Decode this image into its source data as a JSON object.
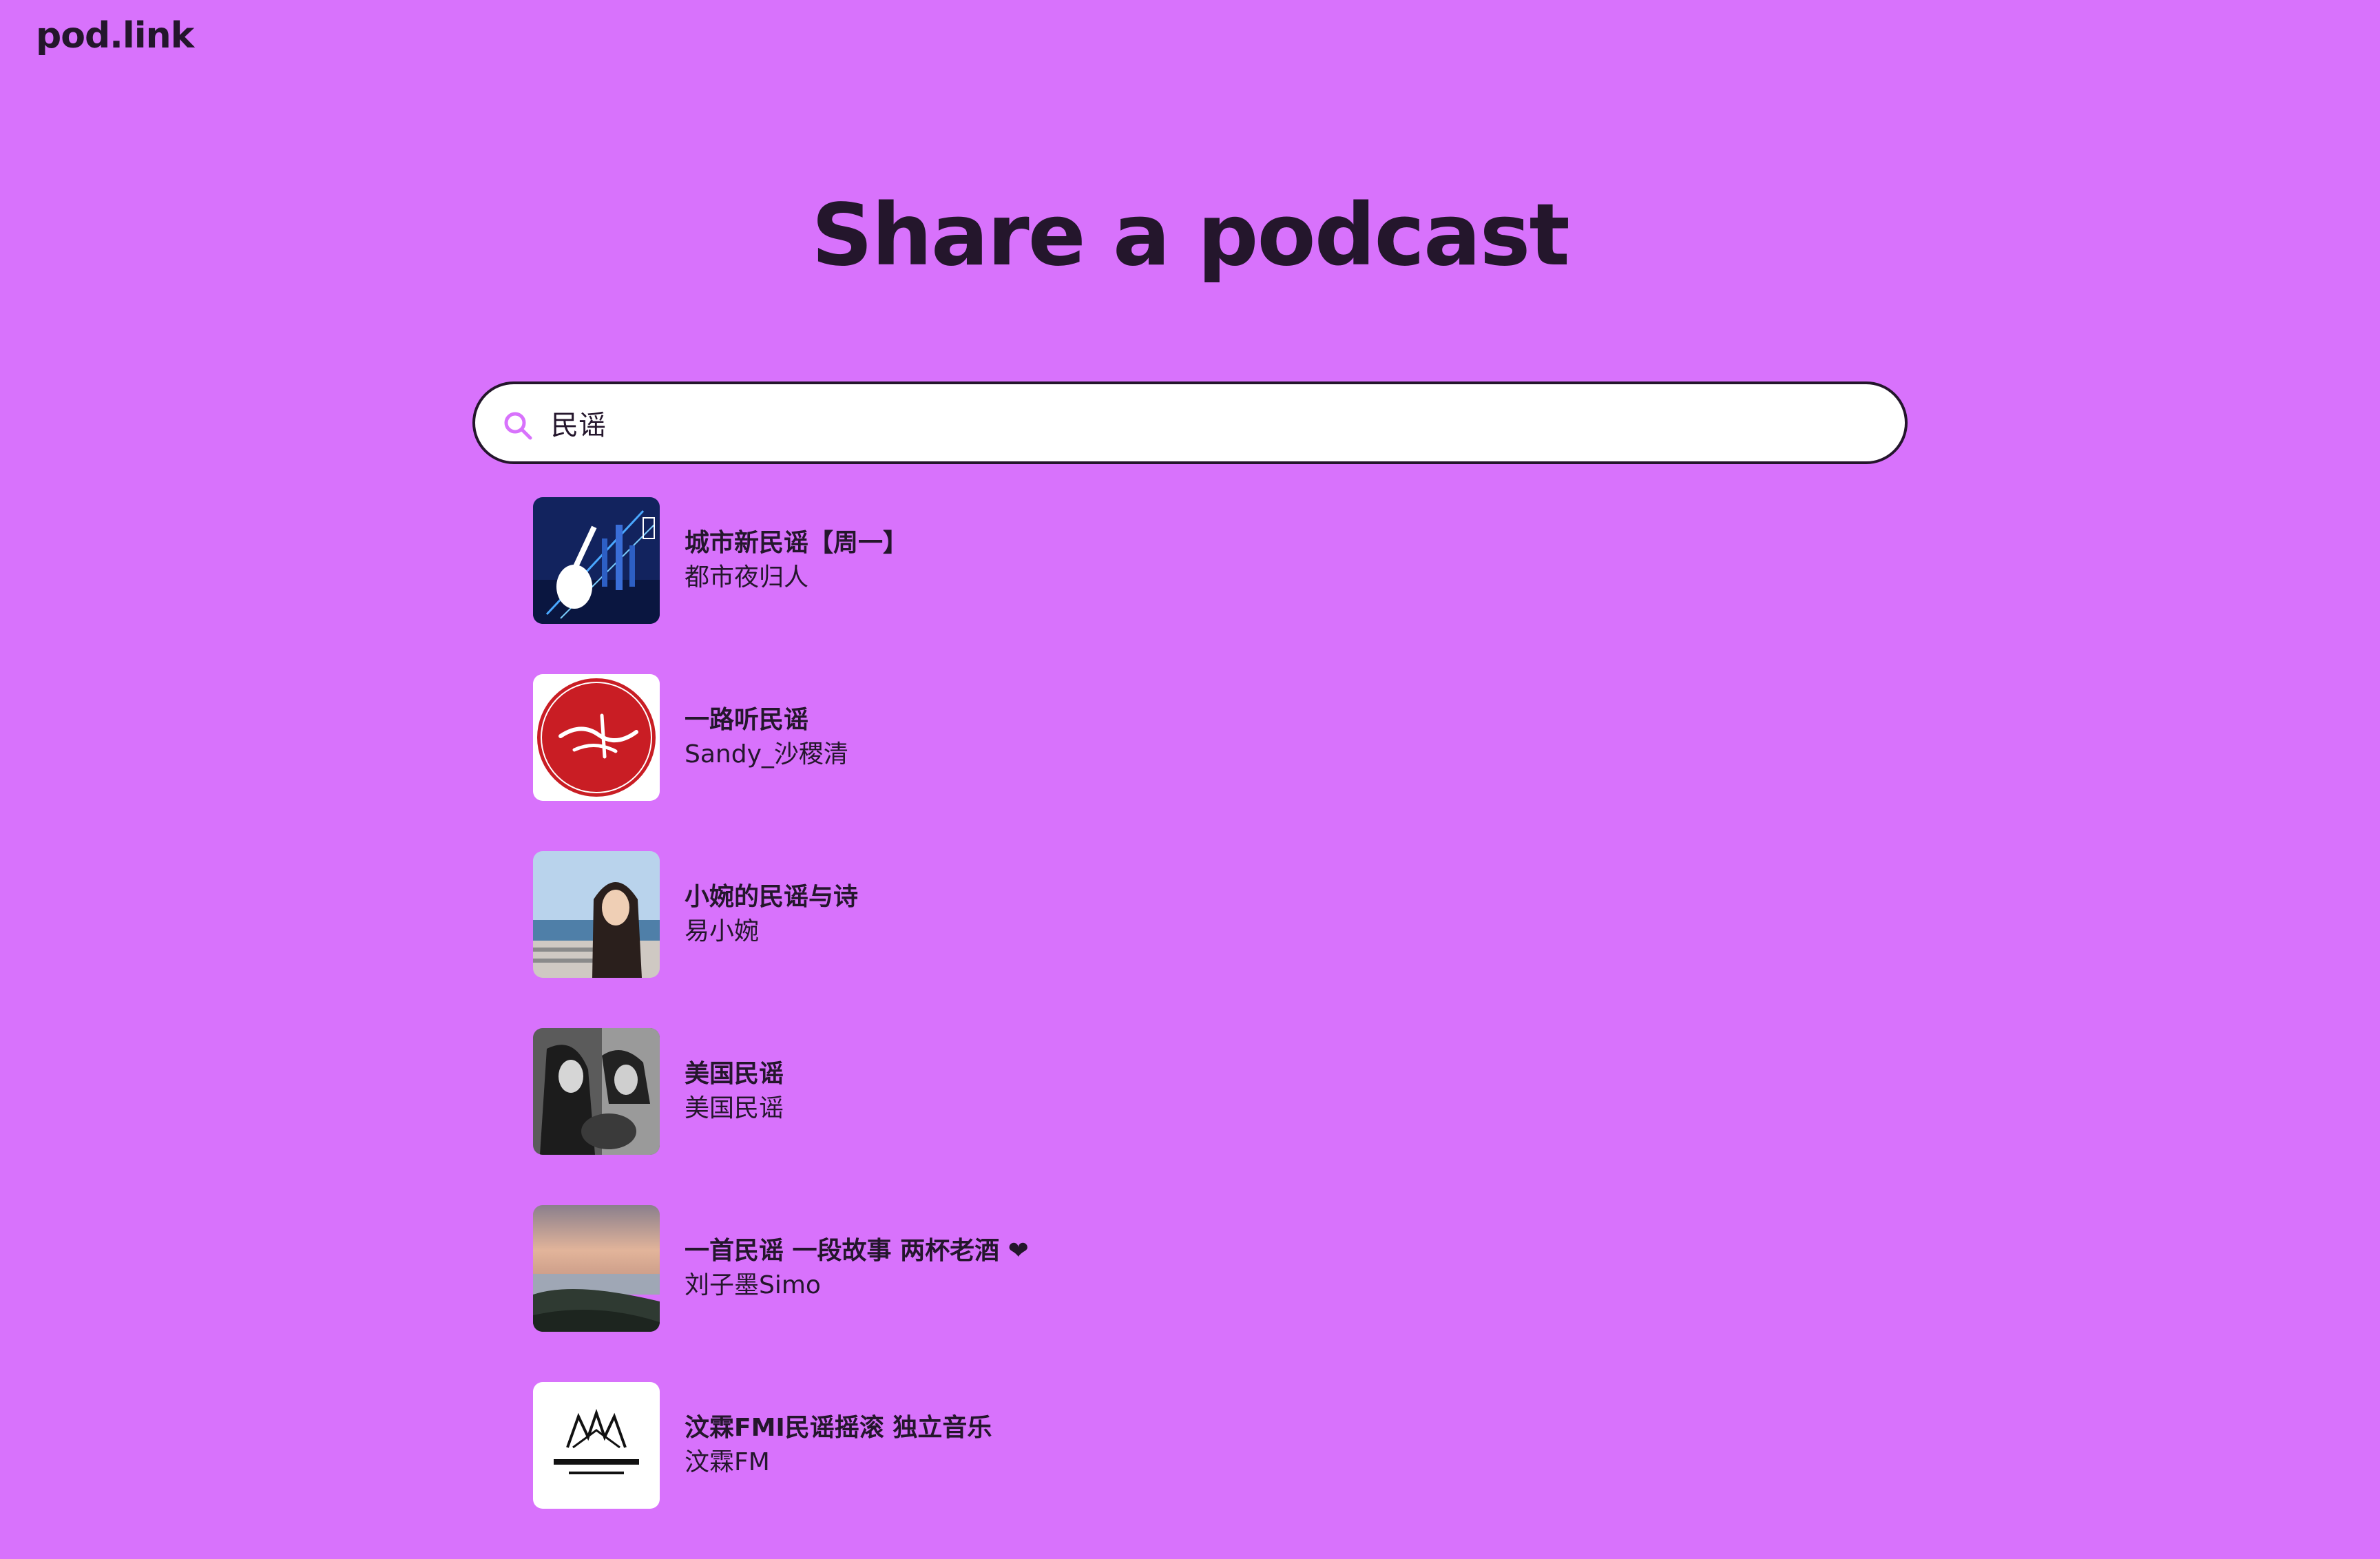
{
  "header": {
    "logo": "pod.link"
  },
  "main": {
    "title": "Share a podcast"
  },
  "search": {
    "value": "民谣",
    "icon": "search-icon"
  },
  "results": [
    {
      "title": "城市新民谣【周一】",
      "author": "都市夜归人",
      "art": "city-guitar-art"
    },
    {
      "title": "一路听民谣",
      "author": "Sandy_沙稷清",
      "art": "red-seal-art"
    },
    {
      "title": "小婉的民谣与诗",
      "author": "易小婉",
      "art": "seaside-portrait-art"
    },
    {
      "title": "美国民谣",
      "author": "美国民谣",
      "art": "bw-guitar-photo-art"
    },
    {
      "title": "一首民谣 一段故事 两杯老酒 ❤",
      "author": "刘子墨Simo",
      "art": "sunset-shore-art"
    },
    {
      "title": "汶霖FMI民谣摇滚 独立音乐",
      "author": "汶霖FM",
      "art": "wenlin-fm-logo-art"
    }
  ],
  "colors": {
    "background": "#d872fc",
    "text": "#24162c",
    "accent": "#d872fc"
  }
}
